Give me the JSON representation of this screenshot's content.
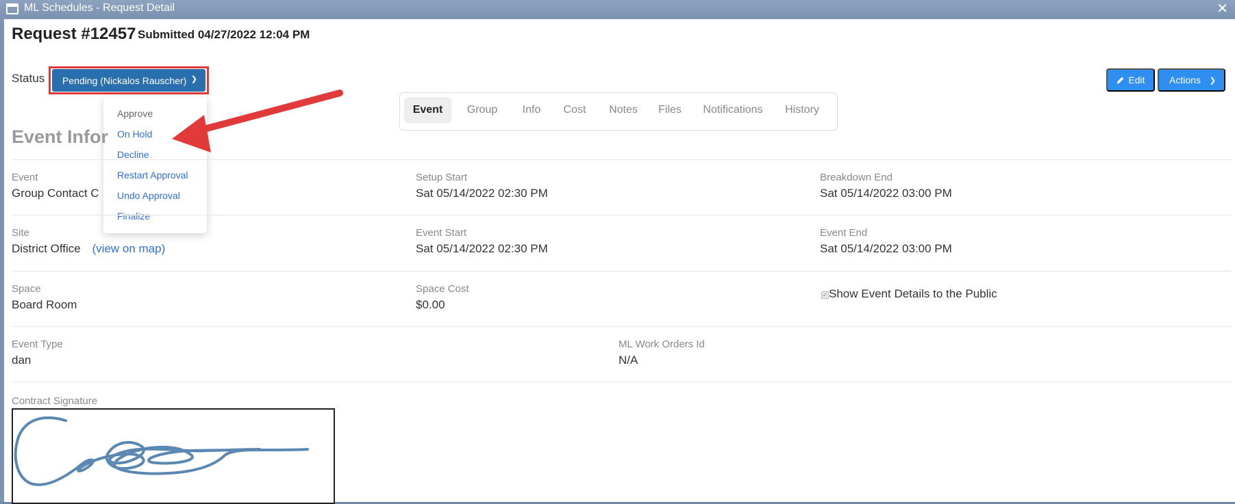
{
  "window": {
    "title": "ML Schedules - Request Detail",
    "close_symbol": "✕"
  },
  "request": {
    "title": "Request #12457",
    "submitted": "Submitted 04/27/2022 12:04 PM"
  },
  "status": {
    "label": "Status",
    "value": "Pending (Nickalos Rauscher)",
    "options": [
      "Approve",
      "On Hold",
      "Decline",
      "Restart Approval",
      "Undo Approval",
      "Finalize"
    ]
  },
  "toolbar": {
    "edit_label": "Edit",
    "actions_label": "Actions"
  },
  "tabs": [
    "Event",
    "Group",
    "Info",
    "Cost",
    "Notes",
    "Files",
    "Notifications",
    "History"
  ],
  "active_tab": "Event",
  "section_title": "Event Infor",
  "fields": {
    "event": {
      "label": "Event",
      "value": "Group Contact C"
    },
    "setup_start": {
      "label": "Setup Start",
      "value": "Sat 05/14/2022 02:30 PM"
    },
    "breakdown_end": {
      "label": "Breakdown End",
      "value": "Sat 05/14/2022 03:00 PM"
    },
    "site": {
      "label": "Site",
      "value": "District Office",
      "link": "(view on map)"
    },
    "event_start": {
      "label": "Event Start",
      "value": "Sat 05/14/2022 02:30 PM"
    },
    "event_end": {
      "label": "Event End",
      "value": "Sat 05/14/2022 03:00 PM"
    },
    "space": {
      "label": "Space",
      "value": "Board Room"
    },
    "space_cost": {
      "label": "Space Cost",
      "value": "$0.00"
    },
    "show_public": {
      "label": "Show Event Details to the Public",
      "checked": true
    },
    "event_type": {
      "label": "Event Type",
      "value": "dan"
    },
    "work_orders": {
      "label": "ML Work Orders Id",
      "value": "N/A"
    },
    "signature": {
      "label": "Contract Signature"
    }
  },
  "colors": {
    "status_button": "#2a6fad",
    "primary_button": "#2f8ff0",
    "annotation_red": "#e03a3a",
    "signature_ink": "#5b88b3",
    "link": "#2f6fd6"
  }
}
